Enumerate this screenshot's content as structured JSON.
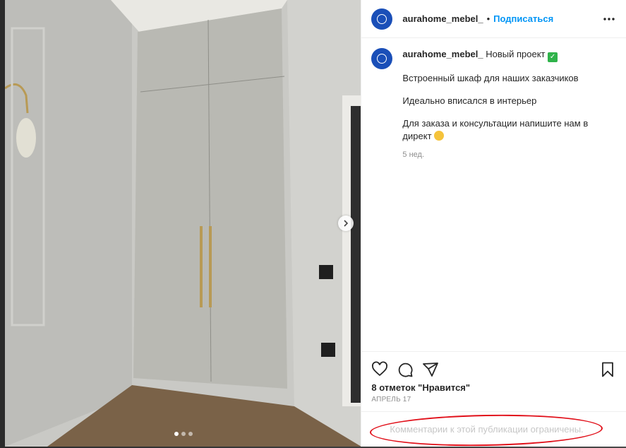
{
  "post": {
    "username": "aurahome_mebel_",
    "separator": "•",
    "follow_label": "Подписаться",
    "caption": {
      "lines": [
        "Новый проект",
        "Встроенный шкаф для наших заказчиков",
        "Идеально вписался в интерьер",
        "Для заказа и консультации напишите нам в директ"
      ],
      "time_ago": "5 нед."
    },
    "likes_text": "8 отметок \"Нравится\"",
    "date_text": "АПРЕЛЬ 17",
    "comments_restricted": "Комментарии к этой публикации ограничены."
  },
  "carousel": {
    "slide_count": 3,
    "active_index": 0
  },
  "colors": {
    "follow": "#0095f6",
    "avatar": "#1a4fb8",
    "annotation": "#e1101a"
  },
  "icons": [
    "more-icon",
    "heart-icon",
    "comment-icon",
    "share-icon",
    "bookmark-icon",
    "chevron-right-icon",
    "check-emoji-icon",
    "smile-emoji-icon"
  ]
}
